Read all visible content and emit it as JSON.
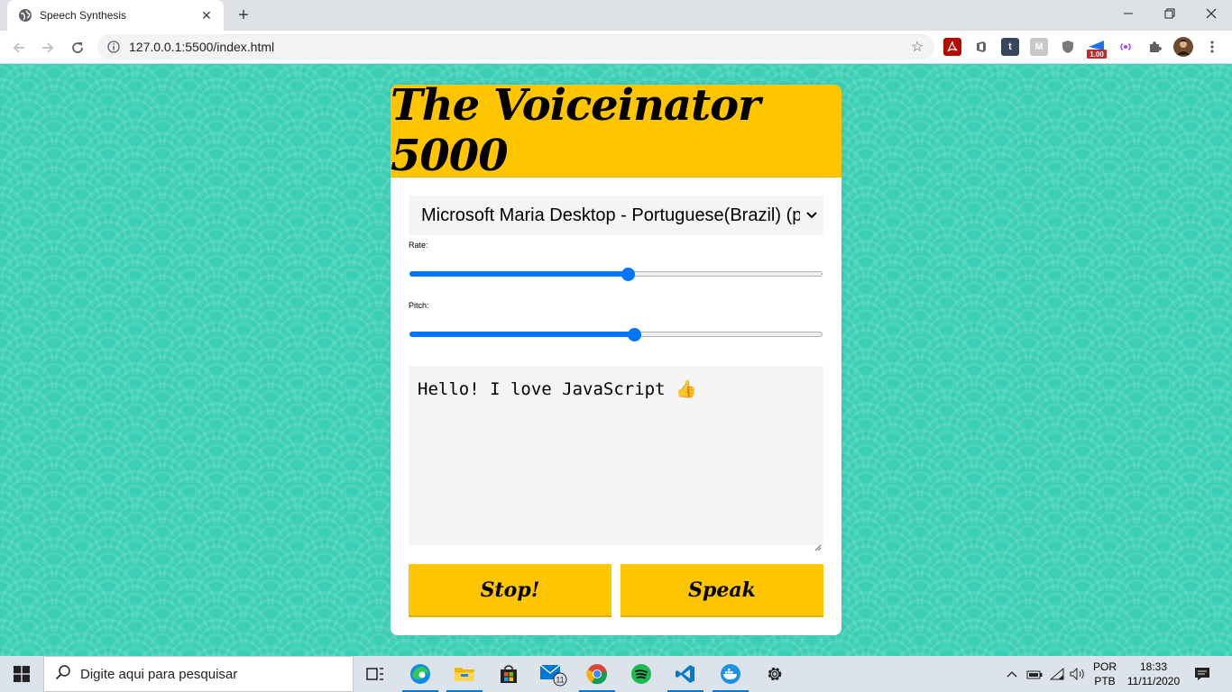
{
  "browser": {
    "tab_title": "Speech Synthesis",
    "url": "127.0.0.1:5500/index.html",
    "extensions": [
      {
        "icon": "pdf-extension-icon",
        "color": "#b30b00"
      },
      {
        "icon": "office-extension-icon",
        "color": "#5f6368"
      },
      {
        "icon": "tumblr-extension-icon",
        "color": "#36465d",
        "text": "t"
      },
      {
        "icon": "m-extension-icon",
        "color": "#c0c0c0",
        "text": "M"
      },
      {
        "icon": "shield-extension-icon",
        "color": "#7a7a7a"
      },
      {
        "icon": "speed-extension-icon",
        "color": "#1a73e8",
        "badge": "1.00"
      },
      {
        "icon": "broadcast-extension-icon",
        "color": "#a142f4"
      },
      {
        "icon": "puzzle-extension-icon",
        "color": "#5f6368"
      },
      {
        "icon": "profile-avatar-icon",
        "color": "#6d4c2f"
      }
    ]
  },
  "app": {
    "title": "The Voiceinator 5000",
    "voice_selected": "Microsoft Maria Desktop - Portuguese(Brazil) (pt-BR)",
    "rate_label": "Rate:",
    "rate_value": 0.53,
    "pitch_label": "Pitch:",
    "pitch_value": 0.545,
    "text": "Hello! I love JavaScript 👍",
    "stop_label": "Stop!",
    "speak_label": "Speak",
    "accent_color": "#ffc600",
    "background_color": "#3bcfb6"
  },
  "taskbar": {
    "search_placeholder": "Digite aqui para pesquisar",
    "mail_badge": "11",
    "lang_top": "POR",
    "lang_bottom": "PTB",
    "time": "18:33",
    "date": "11/11/2020"
  }
}
